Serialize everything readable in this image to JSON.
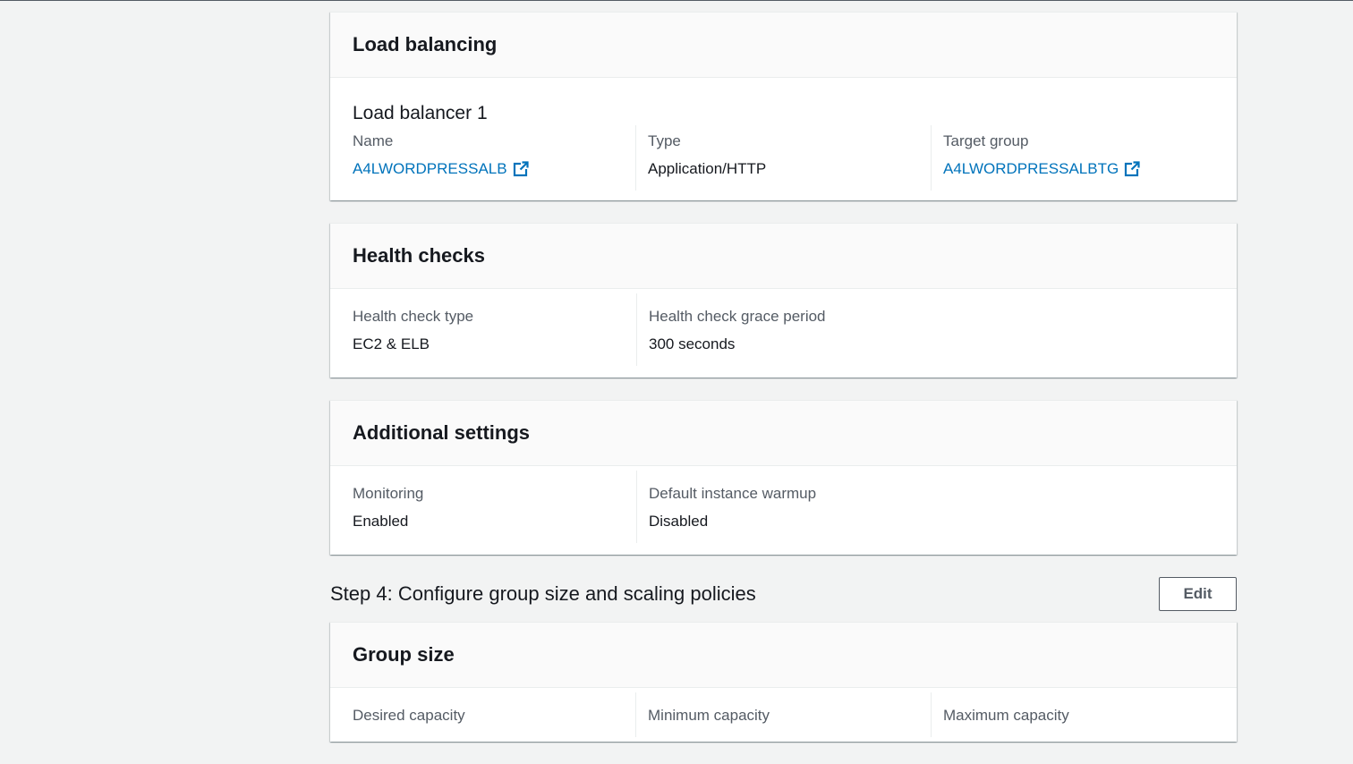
{
  "load_balancing": {
    "title": "Load balancing",
    "lb_heading": "Load balancer 1",
    "name_label": "Name",
    "name_value": "A4LWORDPRESSALB",
    "type_label": "Type",
    "type_value": "Application/HTTP",
    "target_group_label": "Target group",
    "target_group_value": "A4LWORDPRESSALBTG"
  },
  "health_checks": {
    "title": "Health checks",
    "type_label": "Health check type",
    "type_value": "EC2 & ELB",
    "grace_label": "Health check grace period",
    "grace_value": "300 seconds"
  },
  "additional_settings": {
    "title": "Additional settings",
    "monitoring_label": "Monitoring",
    "monitoring_value": "Enabled",
    "warmup_label": "Default instance warmup",
    "warmup_value": "Disabled"
  },
  "step4": {
    "title": "Step 4: Configure group size and scaling policies",
    "edit_label": "Edit"
  },
  "group_size": {
    "title": "Group size",
    "desired_label": "Desired capacity",
    "minimum_label": "Minimum capacity",
    "maximum_label": "Maximum capacity"
  },
  "icons": {
    "external_link": "external-link-icon"
  },
  "colors": {
    "link": "#0073bb",
    "background": "#f2f3f3",
    "panel_header": "#fafafa"
  }
}
